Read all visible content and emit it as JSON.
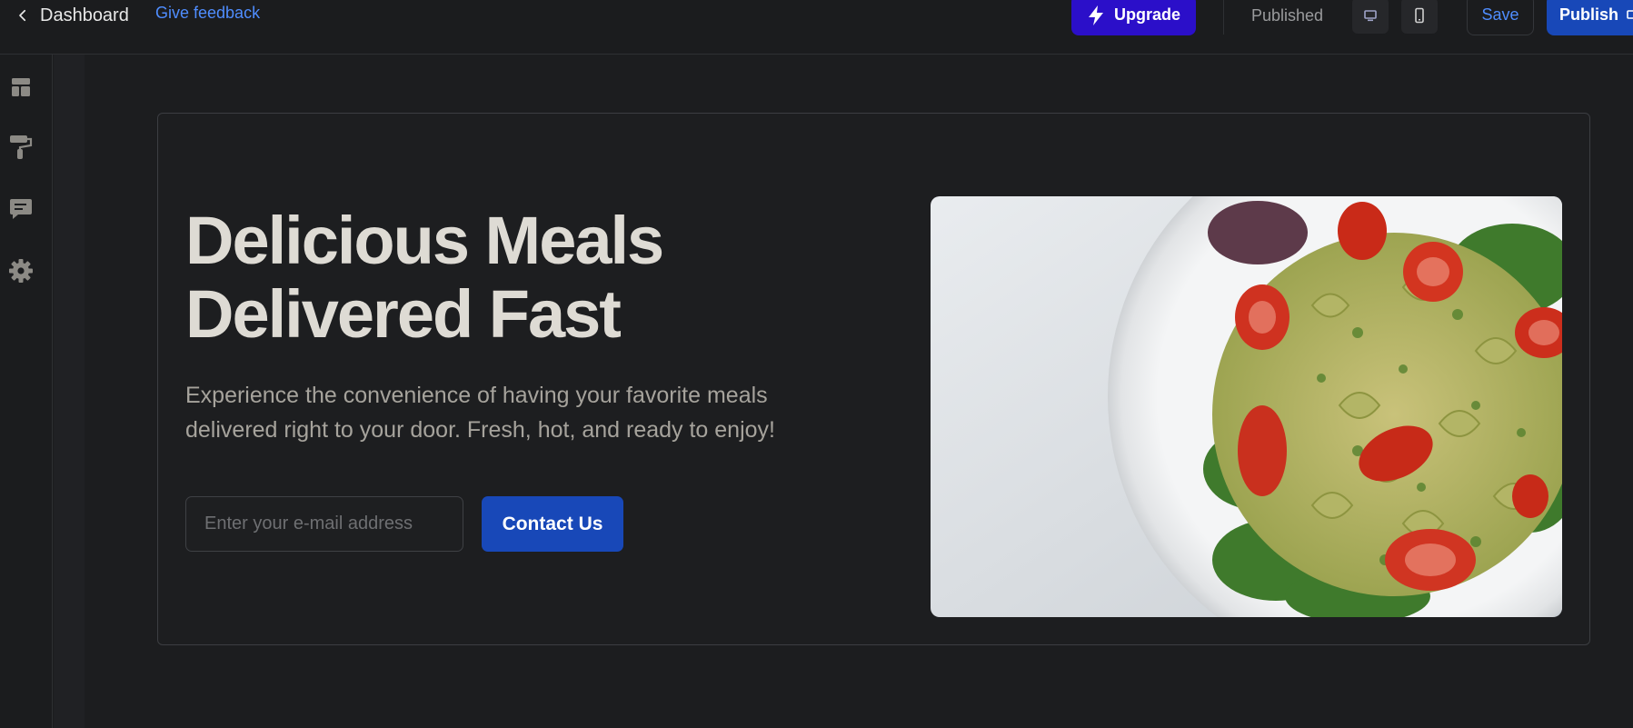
{
  "header": {
    "back_label": "Dashboard",
    "feedback_label": "Give feedback",
    "upgrade_label": "Upgrade",
    "status": "Published",
    "save_label": "Save",
    "publish_label": "Publish"
  },
  "sidebar": {
    "items": [
      {
        "icon": "layout-icon"
      },
      {
        "icon": "paint-roller-icon"
      },
      {
        "icon": "comment-icon"
      },
      {
        "icon": "gear-icon"
      }
    ]
  },
  "hero": {
    "headline_line1": "Delicious Meals",
    "headline_line2": "Delivered Fast",
    "subtitle": "Experience the convenience of having your favorite meals delivered right to your door. Fresh, hot, and ready to enjoy!",
    "email_placeholder": "Enter your e-mail address",
    "email_value": "",
    "cta_label": "Contact Us",
    "image_subject": "pesto bowtie pasta salad with cherry tomatoes"
  },
  "colors": {
    "accent_blue": "#1848b8",
    "link_blue": "#4f8dff",
    "upgrade_purple": "#2b0fc9",
    "background": "#1b1c1e"
  }
}
